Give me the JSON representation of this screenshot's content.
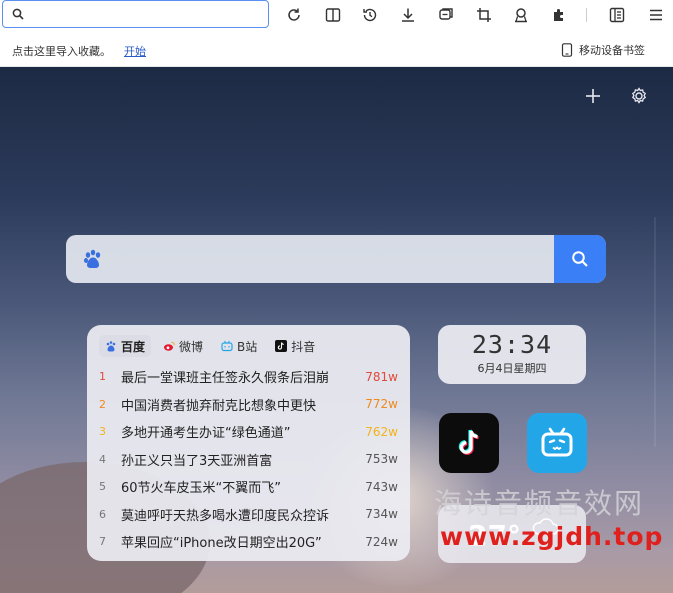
{
  "address_bar": {
    "value": "",
    "placeholder": ""
  },
  "toolbar_icons": [
    "refresh-icon",
    "split-view-icon",
    "history-icon",
    "download-icon",
    "screenshot-icon",
    "crop-icon",
    "account-icon",
    "extensions-icon",
    "reading-list-icon",
    "menu-icon"
  ],
  "bookmarks_bar": {
    "hint": "点击这里导入收藏。",
    "start_link": "开始",
    "mobile_bookmarks": "移动设备书签"
  },
  "search": {
    "placeholder": ""
  },
  "hot_tabs": [
    {
      "label": "百度",
      "active": true
    },
    {
      "label": "微博",
      "active": false
    },
    {
      "label": "B站",
      "active": false
    },
    {
      "label": "抖音",
      "active": false
    }
  ],
  "hot_list": [
    {
      "rank": "1",
      "title": "最后一堂课班主任签永久假条后泪崩",
      "count": "781w"
    },
    {
      "rank": "2",
      "title": "中国消费者抛弃耐克比想象中更快",
      "count": "772w"
    },
    {
      "rank": "3",
      "title": "多地开通考生办证“绿色通道”",
      "count": "762w"
    },
    {
      "rank": "4",
      "title": "孙正义只当了3天亚洲首富",
      "count": "753w"
    },
    {
      "rank": "5",
      "title": "60节火车皮玉米“不翼而飞”",
      "count": "743w"
    },
    {
      "rank": "6",
      "title": "莫迪呼吁天热多喝水遭印度民众控诉",
      "count": "734w"
    },
    {
      "rank": "7",
      "title": "苹果回应“iPhone改日期空出20G”",
      "count": "724w"
    }
  ],
  "clock": {
    "time": "23:34",
    "date": "6月4日星期四"
  },
  "weather": {
    "temp": "27°"
  },
  "watermark": {
    "line1": "海诗音频音效网",
    "line2": "www.zgjdh.top"
  },
  "colors": {
    "accent": "#3a7ff5",
    "rank1": "#e24a3b",
    "rank2": "#f08a1e",
    "rank3": "#f2b31b"
  }
}
